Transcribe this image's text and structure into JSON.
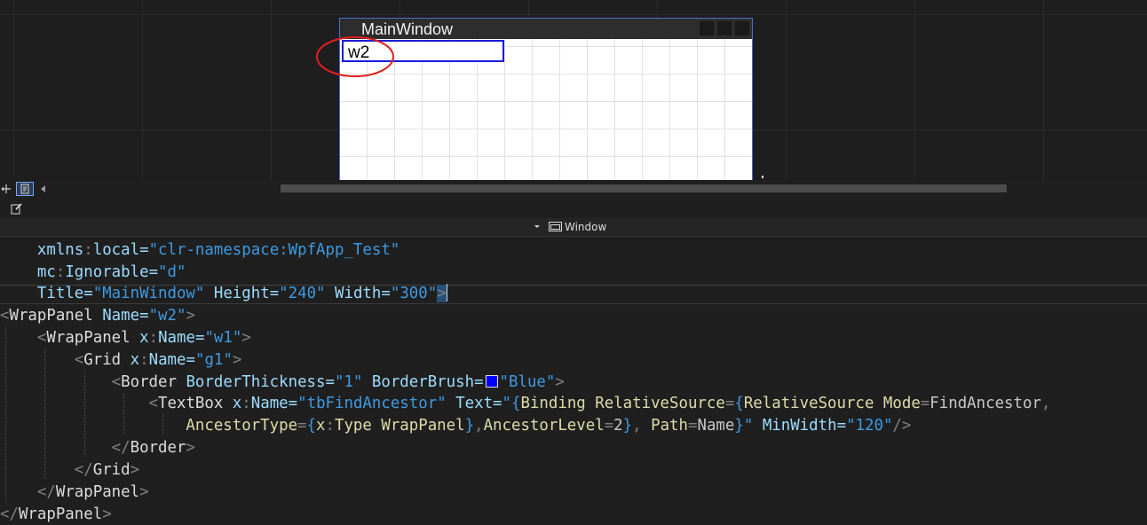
{
  "designer": {
    "window_title": "MainWindow",
    "textbox_text": "w2",
    "annotation_color": "#e02020",
    "window_border_color": "#4a6fd6"
  },
  "navbar": {
    "element_icon": "window-icon",
    "element_label": "Window"
  },
  "editor": {
    "lines": [
      [
        "    ",
        "xmlns",
        ":",
        "local",
        "=",
        "\"clr-namespace:WpfApp_Test\""
      ],
      [
        "    ",
        "mc",
        ":",
        "Ignorable",
        "=",
        "\"d\""
      ],
      [
        "    ",
        "Title",
        "=",
        "\"MainWindow\"",
        " ",
        "Height",
        "=",
        "\"240\"",
        " ",
        "Width",
        "=",
        "\"300\"",
        ">"
      ],
      [
        "<",
        "WrapPanel",
        " ",
        "Name",
        "=",
        "\"w2\"",
        ">"
      ],
      [
        "    ",
        "<",
        "WrapPanel",
        " ",
        "x",
        ":",
        "Name",
        "=",
        "\"w1\"",
        ">"
      ],
      [
        "        ",
        "<",
        "Grid",
        " ",
        "x",
        ":",
        "Name",
        "=",
        "\"g1\"",
        ">"
      ],
      [
        "            ",
        "<",
        "Border",
        " ",
        "BorderThickness",
        "=",
        "\"1\"",
        " ",
        "BorderBrush",
        "=",
        "\"Blue\"",
        ">"
      ],
      [
        "                ",
        "<",
        "TextBox",
        " ",
        "x",
        ":",
        "Name",
        "=",
        "\"tbFindAncestor\"",
        " ",
        "Text",
        "=",
        "\"{",
        "Binding",
        " ",
        "RelativeSource",
        "=",
        "{",
        "RelativeSource",
        " ",
        "Mode",
        "=",
        "FindAncestor",
        ","
      ],
      [
        "                    ",
        "AncestorType",
        "=",
        "{",
        "x",
        ":",
        "Type",
        " ",
        "WrapPanel",
        "}",
        ",",
        "AncestorLevel",
        "=",
        "2",
        "}",
        ",",
        " ",
        "Path",
        "=",
        "Name",
        "}\"",
        " ",
        "MinWidth",
        "=",
        "\"120\"",
        "/>"
      ],
      [
        "            ",
        "</",
        "Border",
        ">"
      ],
      [
        "        ",
        "</",
        "Grid",
        ">"
      ],
      [
        "    ",
        "</",
        "WrapPanel",
        ">"
      ],
      [
        "</",
        "WrapPanel",
        ">"
      ]
    ]
  },
  "colors": {
    "element": "#569cd6",
    "attribute": "#9cdcfe",
    "string": "#3f9ae0",
    "border_brush_swatch": "#0000ff"
  }
}
